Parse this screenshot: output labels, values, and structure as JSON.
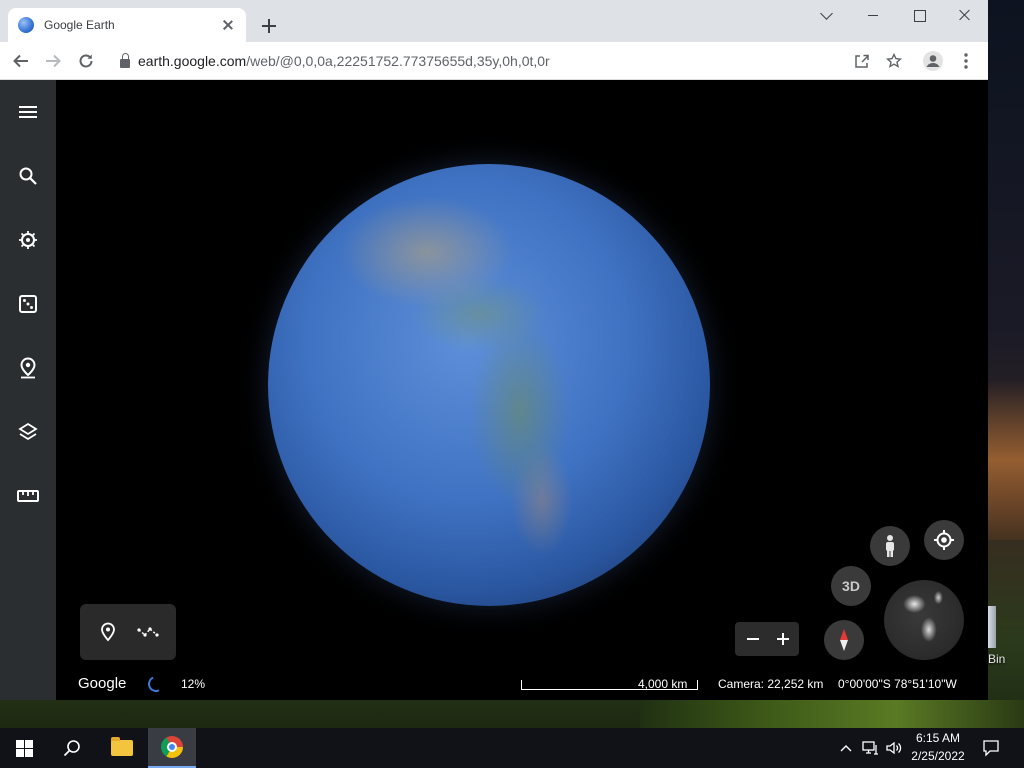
{
  "browser": {
    "tab_title": "Google Earth",
    "url_host": "earth.google.com",
    "url_path": "/web/@0,0,0a,22251752.77375655d,35y,0h,0t,0r"
  },
  "app": {
    "sidebar_items": [
      {
        "icon": "menu-icon"
      },
      {
        "icon": "search-icon"
      },
      {
        "icon": "voyager-icon"
      },
      {
        "icon": "feeling-lucky-dice-icon"
      },
      {
        "icon": "projects-pin-icon"
      },
      {
        "icon": "map-style-layers-icon"
      },
      {
        "icon": "measure-ruler-icon"
      }
    ],
    "view_3d_label": "3D",
    "logo_text": "Google",
    "loading_percent": "12%",
    "scale_label": "4,000 km",
    "camera_text": "Camera: 22,252 km",
    "coords_text": "0°00'00\"S 78°51'10\"W"
  },
  "desktop": {
    "recycle_bin_label": "Bin"
  },
  "taskbar": {
    "time": "6:15 AM",
    "date": "2/25/2022"
  },
  "colors": {
    "sidebar_bg": "#2b2e31",
    "accent_blue": "#3c78d8",
    "tab_strip": "#dee1e6"
  }
}
